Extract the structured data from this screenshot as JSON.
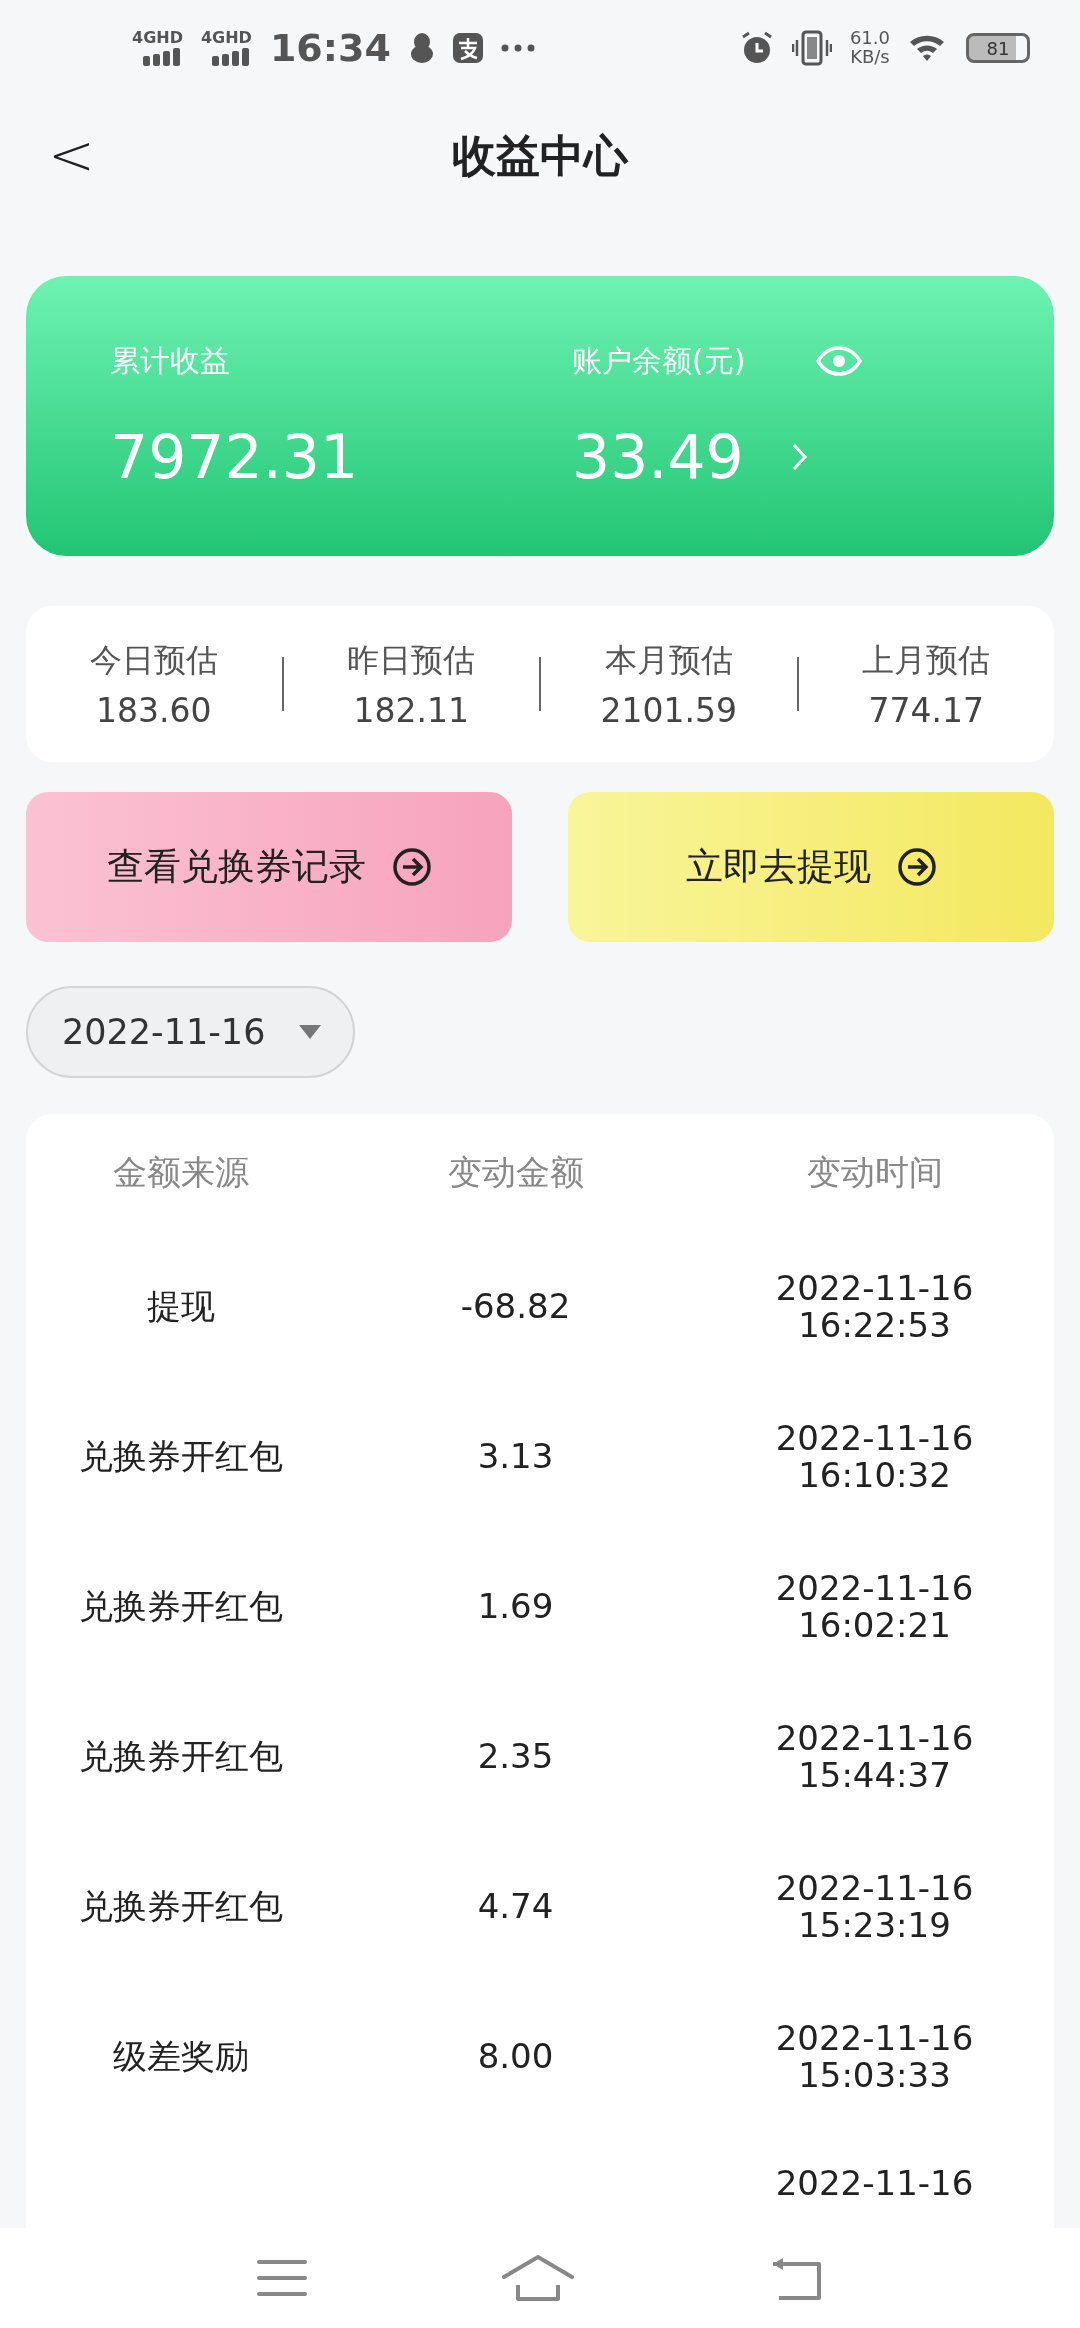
{
  "status_bar": {
    "networks": [
      "4GHD",
      "4GHD"
    ],
    "time": "16:34",
    "speed": "61.0",
    "speed_unit": "KB/s",
    "battery": "81"
  },
  "header": {
    "back": "<",
    "title": "收益中心"
  },
  "summary": {
    "total_label": "累计收益",
    "total": "7972.31",
    "balance_label": "账户余额(元)",
    "balance": "33.49"
  },
  "stats": [
    {
      "label": "今日预估",
      "value": "183.60"
    },
    {
      "label": "昨日预估",
      "value": "182.11"
    },
    {
      "label": "本月预估",
      "value": "2101.59"
    },
    {
      "label": "上月预估",
      "value": "774.17"
    }
  ],
  "actions": [
    {
      "label": "查看兑换券记录",
      "kind": "pink"
    },
    {
      "label": "立即去提现",
      "kind": "yellow"
    }
  ],
  "date_filter": {
    "value": "2022-11-16"
  },
  "table": {
    "columns": [
      "金额来源",
      "变动金额",
      "变动时间"
    ],
    "rows": [
      {
        "source": "提现",
        "amount": "-68.82",
        "date": "2022-11-16",
        "time": "16:22:53"
      },
      {
        "source": "兑换券开红包",
        "amount": "3.13",
        "date": "2022-11-16",
        "time": "16:10:32"
      },
      {
        "source": "兑换券开红包",
        "amount": "1.69",
        "date": "2022-11-16",
        "time": "16:02:21"
      },
      {
        "source": "兑换券开红包",
        "amount": "2.35",
        "date": "2022-11-16",
        "time": "15:44:37"
      },
      {
        "source": "兑换券开红包",
        "amount": "4.74",
        "date": "2022-11-16",
        "time": "15:23:19"
      },
      {
        "source": "级差奖励",
        "amount": "8.00",
        "date": "2022-11-16",
        "time": "15:03:33"
      },
      {
        "date": "2022-11-16"
      }
    ]
  }
}
